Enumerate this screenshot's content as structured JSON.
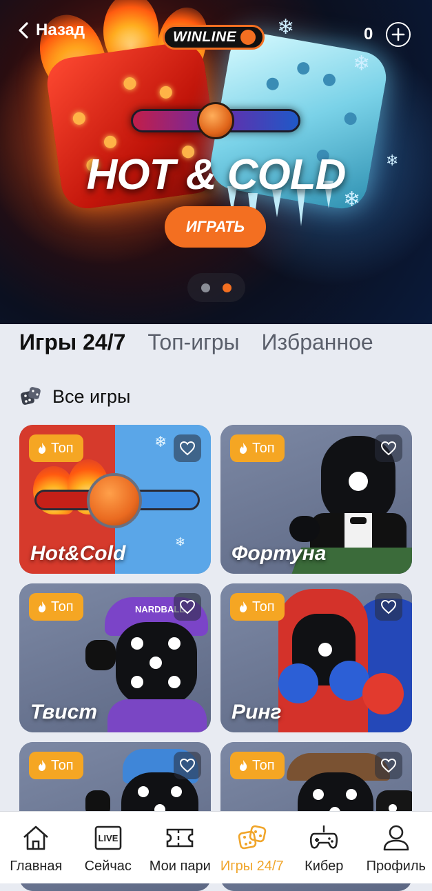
{
  "header": {
    "back_label": "Назад",
    "logo_text": "WINLINE",
    "balance": "0"
  },
  "banner": {
    "title": "HOT & COLD",
    "play_label": "ИГРАТЬ",
    "pages": 2,
    "active_page": 2
  },
  "tabs": [
    {
      "label": "Игры 24/7",
      "active": true
    },
    {
      "label": "Топ-игры",
      "active": false
    },
    {
      "label": "Избранное",
      "active": false
    }
  ],
  "section": {
    "title": "Все игры",
    "icon": "dice-icon"
  },
  "games": [
    {
      "title": "Hot&Cold",
      "badge": "Топ"
    },
    {
      "title": "Фортуна",
      "badge": "Топ"
    },
    {
      "title": "Твист",
      "badge": "Топ"
    },
    {
      "title": "Ринг",
      "badge": "Топ"
    },
    {
      "title": "",
      "badge": "Топ"
    },
    {
      "title": "",
      "badge": "Топ"
    }
  ],
  "twist_cap_text": "NARDBALL",
  "nav": [
    {
      "label": "Главная",
      "icon": "home-icon",
      "active": false
    },
    {
      "label": "Сейчас",
      "icon": "live-icon",
      "icon_text": "LIVE",
      "active": false
    },
    {
      "label": "Мои пари",
      "icon": "ticket-icon",
      "active": false
    },
    {
      "label": "Игры 24/7",
      "icon": "dice-icon",
      "active": true
    },
    {
      "label": "Кибер",
      "icon": "gamepad-icon",
      "active": false
    },
    {
      "label": "Профиль",
      "icon": "profile-icon",
      "active": false
    }
  ],
  "colors": {
    "accent": "#f36f21",
    "badge": "#f5a623",
    "nav_active": "#f0a52a"
  }
}
